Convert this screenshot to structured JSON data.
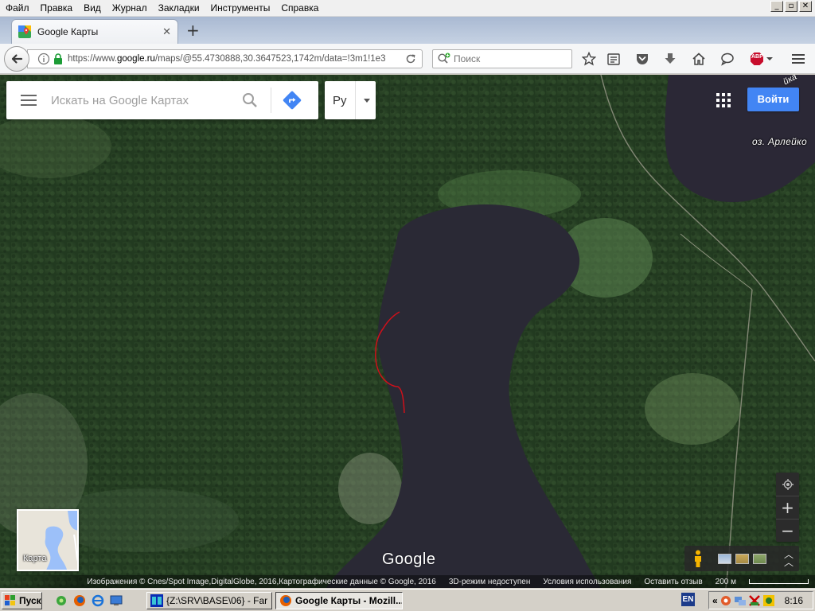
{
  "menubar": {
    "items": [
      "Файл",
      "Правка",
      "Вид",
      "Журнал",
      "Закладки",
      "Инструменты",
      "Справка"
    ],
    "window_buttons": [
      "_",
      "▫",
      "✕"
    ]
  },
  "tabs": [
    {
      "label": "Google Карты",
      "icon": "google-maps-favicon"
    }
  ],
  "newtab_label": "+",
  "navbar": {
    "url_plain": "https://www.",
    "url_host": "google.ru",
    "url_rest": "/maps/@55.4730888,30.3647523,1742m/data=!3m1!1e3",
    "search_placeholder": "Поиск",
    "toolbar_icons": [
      "bookmark-star-icon",
      "reading-list-icon",
      "pocket-icon",
      "downloads-icon",
      "home-icon",
      "chat-bubble-icon",
      "adblock-plus-icon",
      "hamburger-menu-icon"
    ],
    "abp_label": "ABP"
  },
  "maps": {
    "search_placeholder": "Искать на Google Картах",
    "lang": "Ру",
    "signin": "Войти",
    "lake_label": "оз. Арлейко",
    "corner_label": "йка",
    "google_logo": "Google",
    "minimap_label": "Карта",
    "zoom_in": "+",
    "zoom_out": "−",
    "attribution": {
      "imagery": "Изображения © Cnes/Spot Image,DigitalGlobe, 2016,Картографические данные © Google, 2016",
      "mode3d": "3D-режим недоступен",
      "terms": "Условия использования",
      "feedback": "Оставить отзыв",
      "scale": "200 м"
    }
  },
  "taskbar": {
    "start": "Пуск",
    "tasks": [
      {
        "label": "{Z:\\SRV\\BASE\\06} - Far",
        "active": false
      },
      {
        "label": "Google Карты - Mozill...",
        "active": true
      }
    ],
    "lang": "EN",
    "tray_chevron": "«",
    "clock": "8:16"
  },
  "colors": {
    "accent_blue": "#4285f4",
    "forest_dark": "#243d22",
    "water": "#2a2a35",
    "route_red": "#d0101a"
  }
}
